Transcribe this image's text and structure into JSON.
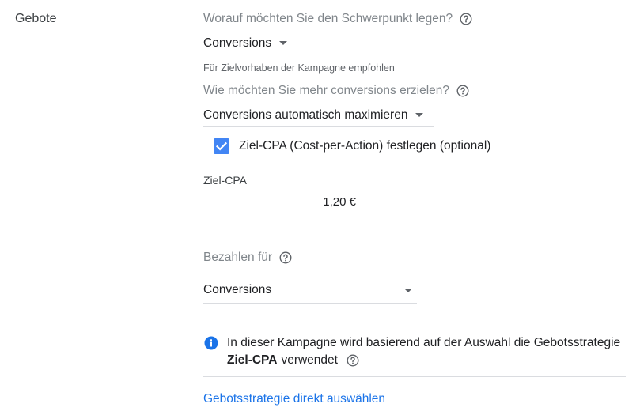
{
  "section": {
    "title": "Gebote"
  },
  "focus": {
    "question": "Worauf möchten Sie den Schwerpunkt legen?",
    "selected": "Conversions",
    "hint": "Für Zielvorhaben der Kampagne empfohlen"
  },
  "strategy": {
    "question": "Wie möchten Sie mehr conversions erzielen?",
    "selected": "Conversions automatisch maximieren"
  },
  "target_cpa": {
    "checkbox_label": "Ziel-CPA (Cost-per-Action) festlegen (optional)",
    "checked": true,
    "field_label": "Ziel-CPA",
    "value": "1,20 €"
  },
  "pay_for": {
    "question": "Bezahlen für",
    "selected": "Conversions"
  },
  "info": {
    "text_line1": "In dieser Kampagne wird basierend auf der Auswahl die Gebotsstrategie",
    "strategy_name": "Ziel-CPA",
    "text_suffix": "verwendet"
  },
  "link": {
    "label": "Gebotsstrategie direkt auswählen"
  },
  "colors": {
    "accent": "#1a73e8",
    "checkbox": "#4285f4",
    "muted": "#80868b"
  }
}
